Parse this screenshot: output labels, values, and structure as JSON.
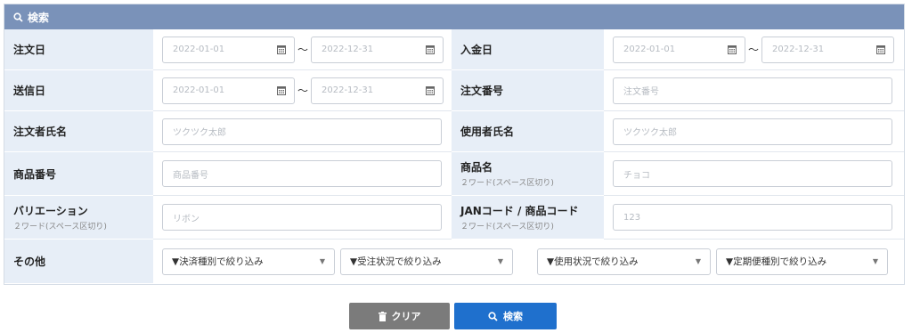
{
  "header": {
    "title": "検索",
    "icon": "search-icon"
  },
  "rows": {
    "order_date": {
      "label": "注文日",
      "from": "2022-01-01",
      "to": "2022-12-31",
      "separator": "〜"
    },
    "payment_date": {
      "label": "入金日",
      "from": "2022-01-01",
      "to": "2022-12-31",
      "separator": "〜"
    },
    "sent_date": {
      "label": "送信日",
      "from": "2022-01-01",
      "to": "2022-12-31",
      "separator": "〜"
    },
    "order_no": {
      "label": "注文番号",
      "placeholder": "注文番号"
    },
    "orderer_name": {
      "label": "注文者氏名",
      "placeholder": "ツクツク太郎"
    },
    "user_name": {
      "label": "使用者氏名",
      "placeholder": "ツクツク太郎"
    },
    "product_no": {
      "label": "商品番号",
      "placeholder": "商品番号"
    },
    "product_name": {
      "label": "商品名",
      "sub": "２ワード(スペース区切り)",
      "placeholder": "チョコ"
    },
    "variation": {
      "label": "バリエーション",
      "sub": "２ワード(スペース区切り)",
      "placeholder": "リボン"
    },
    "jan_code": {
      "label": "JANコード / 商品コード",
      "sub": "２ワード(スペース区切り)",
      "placeholder": "123"
    },
    "other": {
      "label": "その他",
      "selects": [
        "▼決済種別で絞り込み",
        "▼受注状況で絞り込み",
        "▼使用状況で絞り込み",
        "▼定期便種別で絞り込み"
      ]
    }
  },
  "buttons": {
    "clear": "クリア",
    "search": "検索"
  },
  "colors": {
    "header_bg": "#7a92b9",
    "label_bg": "#e7eef7",
    "clear_bg": "#7b7b7b",
    "search_bg": "#1f70cd"
  }
}
